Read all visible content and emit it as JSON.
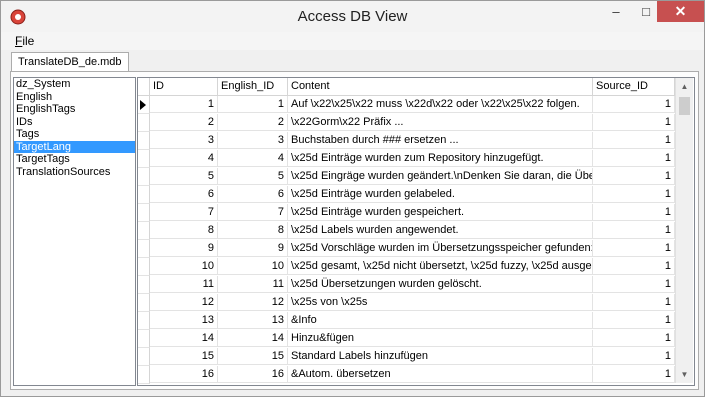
{
  "window": {
    "title": "Access DB View"
  },
  "menu": {
    "file_label": "File"
  },
  "tabs": [
    {
      "label": "TranslateDB_de.mdb"
    }
  ],
  "tables": [
    "dz_System",
    "English",
    "EnglishTags",
    "IDs",
    "Tags",
    "TargetLang",
    "TargetTags",
    "TranslationSources"
  ],
  "selected_table": "TargetLang",
  "grid": {
    "columns": [
      "ID",
      "English_ID",
      "Content",
      "Source_ID"
    ],
    "rows": [
      [
        "1",
        "1",
        "Auf \\x22\\x25\\x22 muss  \\x22d\\x22 oder \\x22\\x25\\x22 folgen.",
        "1"
      ],
      [
        "2",
        "2",
        "\\x22Gorm\\x22 Präfix ...",
        "1"
      ],
      [
        "3",
        "3",
        "Buchstaben durch ### ersetzen ...",
        "1"
      ],
      [
        "4",
        "4",
        "\\x25d Einträge wurden zum Repository hinzugefügt.",
        "1"
      ],
      [
        "5",
        "5",
        "\\x25d Eingräge wurden geändert.\\nDenken Sie daran, die Über",
        "1"
      ],
      [
        "6",
        "6",
        "\\x25d Einträge wurden gelabeled.",
        "1"
      ],
      [
        "7",
        "7",
        "\\x25d Einträge wurden gespeichert.",
        "1"
      ],
      [
        "8",
        "8",
        "\\x25d Labels wurden angewendet.",
        "1"
      ],
      [
        "9",
        "9",
        "\\x25d Vorschläge wurden im Übersetzungsspeicher gefunden:",
        "1"
      ],
      [
        "10",
        "10",
        "\\x25d gesamt, \\x25d nicht übersetzt, \\x25d fuzzy, \\x25d ausge",
        "1"
      ],
      [
        "11",
        "11",
        "\\x25d Übersetzungen wurden gelöscht.",
        "1"
      ],
      [
        "12",
        "12",
        "\\x25s von \\x25s",
        "1"
      ],
      [
        "13",
        "13",
        "&Info",
        "1"
      ],
      [
        "14",
        "14",
        "Hinzu&fügen",
        "1"
      ],
      [
        "15",
        "15",
        "Standard Labels hinzufügen",
        "1"
      ],
      [
        "16",
        "16",
        "&Autom. übersetzen",
        "1"
      ]
    ]
  },
  "colors": {
    "selection": "#3399ff",
    "close_button": "#c75050"
  }
}
